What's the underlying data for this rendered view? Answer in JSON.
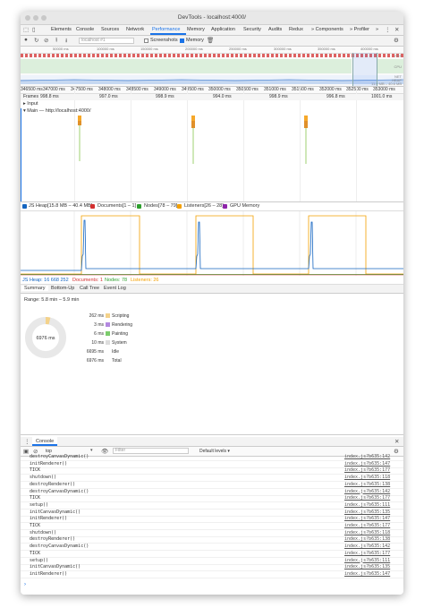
{
  "window": {
    "title": "DevTools - localhost:4000/"
  },
  "tabs": [
    "Elements",
    "Console",
    "Sources",
    "Network",
    "Performance",
    "Memory",
    "Application",
    "Security",
    "Audits",
    "Redux",
    "» Components",
    "» Profiler",
    "»"
  ],
  "active_tab": "Performance",
  "toolbar": {
    "recording_placeholder": "localhost #1",
    "screenshots_label": "Screenshots",
    "memory_label": "Memory",
    "screenshots_checked": false,
    "memory_checked": true
  },
  "overview": {
    "ruler_ticks": [
      "50000 ms",
      "100000 ms",
      "150000 ms",
      "200000 ms",
      "250000 ms",
      "300000 ms",
      "350000 ms",
      "400000 ms"
    ],
    "fps_label": "FPS",
    "cpu_label": "CPU",
    "net_label": "NET",
    "heap_label": "HEAP",
    "heap_range": "11.0 MB – 40.6 MB"
  },
  "main_ruler": [
    "346500 ms",
    "347000 ms",
    "347500 ms",
    "348000 ms",
    "348500 ms",
    "349000 ms",
    "349500 ms",
    "350000 ms",
    "350500 ms",
    "351000 ms",
    "351500 ms",
    "352000 ms",
    "352500 ms",
    "353000 ms"
  ],
  "frames": {
    "label": "Frames",
    "values": [
      "998.8 ms",
      "997.0 ms",
      "998.9 ms",
      "994.0 ms",
      "998.9 ms",
      "996.8 ms",
      "1001.0 ms"
    ]
  },
  "tracks": {
    "input_label": "▸ Input",
    "main_label": "▾ Main — http://localhost:4000/"
  },
  "memory_legend": [
    {
      "label": "JS Heap[15.8 MB – 40.4 MB]",
      "color": "#1565c0"
    },
    {
      "label": "Documents[1 – 1]",
      "color": "#d32f2f"
    },
    {
      "label": "Nodes[78 – 79]",
      "color": "#2e9f2e"
    },
    {
      "label": "Listeners[26 – 28]",
      "color": "#f4a000"
    },
    {
      "label": "GPU Memory",
      "color": "#8e24aa"
    }
  ],
  "memory_stats": [
    {
      "label": "JS Heap: 16 668 252",
      "color": "#1565c0"
    },
    {
      "label": "Documents: 1",
      "color": "#d32f2f"
    },
    {
      "label": "Nodes: 78",
      "color": "#2e9f2e"
    },
    {
      "label": "Listeners: 26",
      "color": "#f4a000"
    }
  ],
  "subtabs": [
    "Summary",
    "Bottom-Up",
    "Call Tree",
    "Event Log"
  ],
  "summary": {
    "range": "Range: 5.8 min – 5.9 min",
    "total_center": "6976 ms",
    "rows": [
      {
        "value": "262 ms",
        "label": "Scripting",
        "color": "#f4d28a"
      },
      {
        "value": "3 ms",
        "label": "Rendering",
        "color": "#b389e0"
      },
      {
        "value": "6 ms",
        "label": "Painting",
        "color": "#7ccc6c"
      },
      {
        "value": "10 ms",
        "label": "System",
        "color": "#dddddd"
      },
      {
        "value": "6695 ms",
        "label": "Idle",
        "color": "#ffffff"
      },
      {
        "value": "6976 ms",
        "label": "Total",
        "color": "#ffffff"
      }
    ]
  },
  "console": {
    "title": "Console",
    "context": "top",
    "filter_placeholder": "Filter",
    "levels": "Default levels ▾",
    "logs": [
      {
        "msg": "destroyCanvasDynamic()",
        "src": "index.js?b635:142"
      },
      {
        "msg": "initRenderer()",
        "src": "index.js?b635:147"
      },
      {
        "msg": "TICK",
        "src": "index.js?b635:177"
      },
      {
        "msg": "shutdown()",
        "src": "index.js?b635:118"
      },
      {
        "msg": "destroyRenderer()",
        "src": "index.js?b635:138"
      },
      {
        "msg": "destroyCanvasDynamic()",
        "src": "index.js?b635:142"
      },
      {
        "msg": "TICK",
        "src": "index.js?b635:177"
      },
      {
        "msg": "setup()",
        "src": "index.js?b635:111"
      },
      {
        "msg": "initCanvasDynamic()",
        "src": "index.js?b635:135"
      },
      {
        "msg": "initRenderer()",
        "src": "index.js?b635:147"
      },
      {
        "msg": "TICK",
        "src": "index.js?b635:177"
      },
      {
        "msg": "shutdown()",
        "src": "index.js?b635:118"
      },
      {
        "msg": "destroyRenderer()",
        "src": "index.js?b635:138"
      },
      {
        "msg": "destroyCanvasDynamic()",
        "src": "index.js?b635:142"
      },
      {
        "msg": "TICK",
        "src": "index.js?b635:177"
      },
      {
        "msg": "setup()",
        "src": "index.js?b635:111"
      },
      {
        "msg": "initCanvasDynamic()",
        "src": "index.js?b635:135"
      },
      {
        "msg": "initRenderer()",
        "src": "index.js?b635:147"
      }
    ]
  }
}
